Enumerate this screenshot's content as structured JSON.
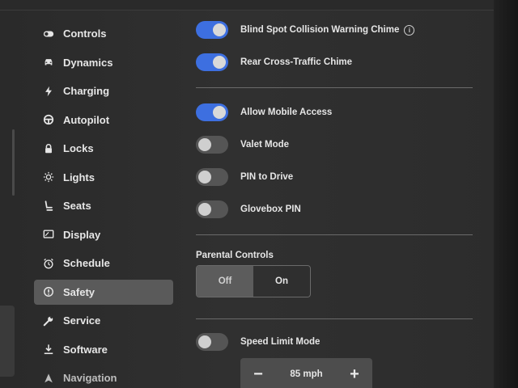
{
  "sidebar": {
    "items": [
      {
        "label": "Controls",
        "icon": "toggle-icon"
      },
      {
        "label": "Dynamics",
        "icon": "car-icon"
      },
      {
        "label": "Charging",
        "icon": "lightning-icon"
      },
      {
        "label": "Autopilot",
        "icon": "steering-wheel-icon"
      },
      {
        "label": "Locks",
        "icon": "lock-icon"
      },
      {
        "label": "Lights",
        "icon": "sun-icon"
      },
      {
        "label": "Seats",
        "icon": "seat-icon"
      },
      {
        "label": "Display",
        "icon": "display-icon"
      },
      {
        "label": "Schedule",
        "icon": "alarm-clock-icon"
      },
      {
        "label": "Safety",
        "icon": "alert-circle-icon",
        "active": true
      },
      {
        "label": "Service",
        "icon": "wrench-icon"
      },
      {
        "label": "Software",
        "icon": "download-icon"
      },
      {
        "label": "Navigation",
        "icon": "navigation-arrow-icon"
      }
    ]
  },
  "settings": {
    "blind_spot": {
      "label": "Blind Spot Collision Warning Chime",
      "on": true
    },
    "rear_cross": {
      "label": "Rear Cross-Traffic Chime",
      "on": true
    },
    "mobile_access": {
      "label": "Allow Mobile Access",
      "on": true
    },
    "valet": {
      "label": "Valet Mode",
      "on": false
    },
    "pin_drive": {
      "label": "PIN to Drive",
      "on": false
    },
    "glovebox": {
      "label": "Glovebox PIN",
      "on": false
    },
    "speed_limit": {
      "label": "Speed Limit Mode",
      "on": false
    }
  },
  "parental_controls": {
    "title": "Parental Controls",
    "options": [
      "Off",
      "On"
    ],
    "selected": "Off"
  },
  "speed_stepper": {
    "minus": "−",
    "value": "85 mph",
    "plus": "+"
  },
  "colors": {
    "toggle_on": "#3d6fe0",
    "toggle_off": "#555555",
    "active_nav": "#5a5a5a"
  }
}
